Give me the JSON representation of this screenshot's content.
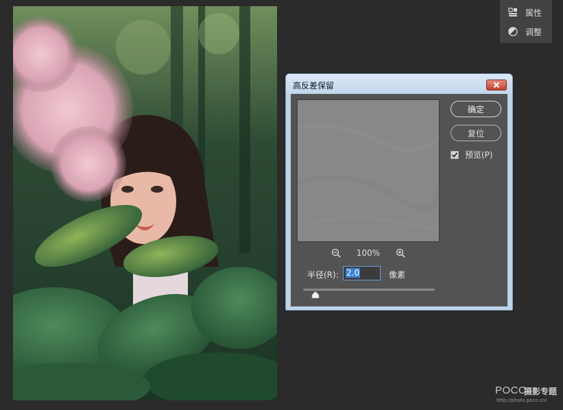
{
  "side_panel": {
    "items": [
      {
        "label": "属性",
        "icon": "properties-icon"
      },
      {
        "label": "调整",
        "icon": "adjustments-icon"
      }
    ]
  },
  "dialog": {
    "title": "高反差保留",
    "ok_label": "确定",
    "reset_label": "复位",
    "preview_label": "预览(P)",
    "preview_checked": true,
    "zoom_level": "100%",
    "radius_label": "半径(R):",
    "radius_value": "2.0",
    "radius_unit": "像素",
    "radius_slider_value": 2.0
  },
  "canvas": {
    "description_icon": "photo-layer"
  },
  "watermark": {
    "brand": "POCO",
    "subtitle": "摄影专题",
    "url": "http://photo.poco.cn/"
  },
  "colors": {
    "dialog_frame": "#bcd3ea",
    "dialog_body": "#535353",
    "preview_gray": "#888888",
    "selection": "#3b83d6",
    "close_red": "#c4432e"
  }
}
